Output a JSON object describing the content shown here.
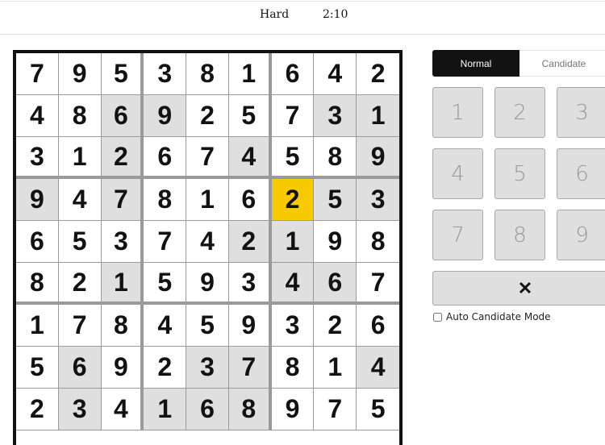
{
  "header": {
    "difficulty": "Hard",
    "timer": "2:10"
  },
  "board": {
    "rows": [
      [
        7,
        9,
        5,
        3,
        8,
        1,
        6,
        4,
        2
      ],
      [
        4,
        8,
        6,
        9,
        2,
        5,
        7,
        3,
        1
      ],
      [
        3,
        1,
        2,
        6,
        7,
        4,
        5,
        8,
        9
      ],
      [
        9,
        4,
        7,
        8,
        1,
        6,
        2,
        5,
        3
      ],
      [
        6,
        5,
        3,
        7,
        4,
        2,
        1,
        9,
        8
      ],
      [
        8,
        2,
        1,
        5,
        9,
        3,
        4,
        6,
        7
      ],
      [
        1,
        7,
        8,
        4,
        5,
        9,
        3,
        2,
        6
      ],
      [
        5,
        6,
        9,
        2,
        3,
        7,
        8,
        1,
        4
      ],
      [
        2,
        3,
        4,
        1,
        6,
        8,
        9,
        7,
        5
      ]
    ],
    "selected_cell": [
      3,
      6
    ],
    "highlighted_cells": [
      [
        1,
        2
      ],
      [
        1,
        3
      ],
      [
        1,
        7
      ],
      [
        1,
        8
      ],
      [
        2,
        2
      ],
      [
        2,
        5
      ],
      [
        2,
        8
      ],
      [
        3,
        0
      ],
      [
        3,
        2
      ],
      [
        3,
        7
      ],
      [
        3,
        8
      ],
      [
        4,
        5
      ],
      [
        4,
        6
      ],
      [
        5,
        2
      ],
      [
        5,
        6
      ],
      [
        5,
        7
      ],
      [
        7,
        1
      ],
      [
        7,
        4
      ],
      [
        7,
        5
      ],
      [
        7,
        8
      ],
      [
        8,
        1
      ],
      [
        8,
        3
      ],
      [
        8,
        4
      ],
      [
        8,
        5
      ]
    ],
    "colors": {
      "selected": "#f7c900",
      "highlight": "#dfdfdf",
      "border": "#121212",
      "grid_line": "#9a9a9a"
    }
  },
  "panel": {
    "mode_tabs": [
      {
        "label": "Normal",
        "active": true
      },
      {
        "label": "Candidate",
        "active": false
      }
    ],
    "keypad": [
      "1",
      "2",
      "3",
      "4",
      "5",
      "6",
      "7",
      "8",
      "9"
    ],
    "erase_icon": "close-x-icon",
    "erase_glyph": "✕",
    "auto_candidate_label": "Auto Candidate Mode",
    "auto_candidate_checked": false
  }
}
